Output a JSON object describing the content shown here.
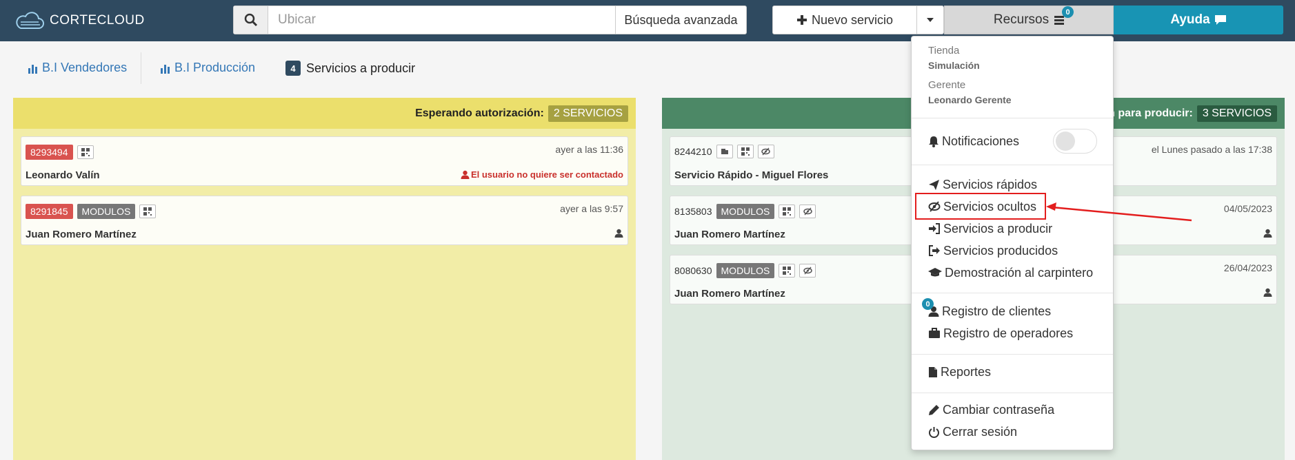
{
  "app": {
    "logo_text": "CORTECLOUD"
  },
  "header": {
    "search_placeholder": "Ubicar",
    "advanced_search": "Búsqueda avanzada",
    "new_service": "Nuevo servicio",
    "resources": "Recursos",
    "resources_badge": "0",
    "help": "Ayuda"
  },
  "nav": {
    "tab1": "B.I Vendedores",
    "tab2": "B.I Producción",
    "tab3_count": "4",
    "tab3": "Servicios a producir"
  },
  "panel_left": {
    "title": "Esperando autorización:",
    "count_label": "2 SERVICIOS",
    "cards": [
      {
        "id": "8293494",
        "time": "ayer a las 11:36",
        "name": "Leonardo Valín",
        "note": "El usuario no quiere ser contactado"
      },
      {
        "id": "8291845",
        "tag": "MODULOS",
        "time": "ayer a las 9:57",
        "name": "Juan Romero Martínez"
      }
    ]
  },
  "panel_right": {
    "title": "ón para producir:",
    "count_label": "3 SERVICIOS",
    "cards": [
      {
        "id": "8244210",
        "time": "el Lunes pasado a las 17:38",
        "name": "Servicio Rápido - Miguel Flores"
      },
      {
        "id": "8135803",
        "tag": "MODULOS",
        "time": "04/05/2023",
        "name": "Juan Romero Martínez"
      },
      {
        "id": "8080630",
        "tag": "MODULOS",
        "time": "26/04/2023",
        "name": "Juan Romero Martínez"
      }
    ]
  },
  "dropdown": {
    "store_label": "Tienda",
    "store_value": "Simulación",
    "manager_label": "Gerente",
    "manager_value": "Leonardo Gerente",
    "notifications": "Notificaciones",
    "notifications_on": false,
    "quick_services": "Servicios rápidos",
    "hidden_services": "Servicios ocultos",
    "to_produce": "Servicios a producir",
    "produced": "Servicios producidos",
    "demo": "Demostración al carpintero",
    "clients": "Registro de clientes",
    "clients_badge": "0",
    "operators": "Registro de operadores",
    "reports": "Reportes",
    "change_password": "Cambiar contraseña",
    "logout": "Cerrar sesión"
  },
  "colors": {
    "topbar": "#2f4a60",
    "help": "#1894b4",
    "yellow_panel": "#f2eda7",
    "green_panel": "#dde9df",
    "highlight": "#e31d1d"
  }
}
